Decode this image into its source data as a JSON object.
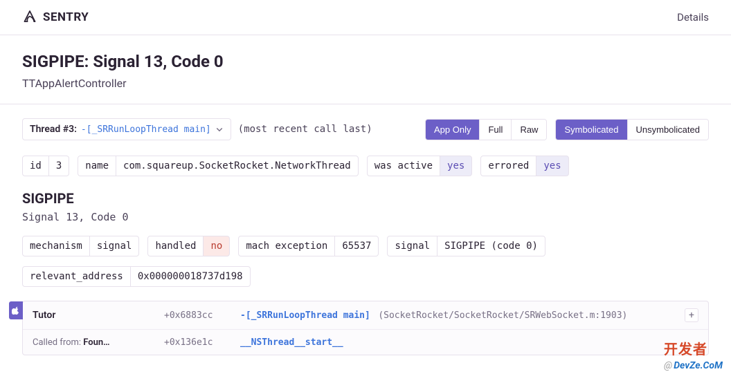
{
  "header": {
    "brand": "SENTRY",
    "details": "Details"
  },
  "title": {
    "main": "SIGPIPE: Signal 13, Code 0",
    "sub": "TTAppAlertController"
  },
  "thread": {
    "label": "Thread #3:",
    "func": "-[_SRRunLoopThread main]"
  },
  "recent": "(most recent call last)",
  "viewGroup": {
    "app": "App Only",
    "full": "Full",
    "raw": "Raw"
  },
  "symGroup": {
    "sym": "Symbolicated",
    "unsym": "Unsymbolicated"
  },
  "tags1": {
    "id": {
      "k": "id",
      "v": "3"
    },
    "name": {
      "k": "name",
      "v": "com.squareup.SocketRocket.NetworkThread"
    },
    "active": {
      "k": "was active",
      "v": "yes"
    },
    "errored": {
      "k": "errored",
      "v": "yes"
    }
  },
  "sig": {
    "title": "SIGPIPE",
    "sub": "Signal 13, Code 0"
  },
  "tags2": {
    "mech": {
      "k": "mechanism",
      "v": "signal"
    },
    "handled": {
      "k": "handled",
      "v": "no"
    },
    "mach": {
      "k": "mach exception",
      "v": "65537"
    },
    "signal": {
      "k": "signal",
      "v": "SIGPIPE (code 0)"
    }
  },
  "tags3": {
    "reladdr": {
      "k": "relevant_address",
      "v": "0x000000018737d198"
    }
  },
  "frames": [
    {
      "pkg": "Tutor",
      "addr": "+0x6883cc",
      "func": "-[_SRRunLoopThread main]",
      "src": "(SocketRocket/SocketRocket/SRWebSocket.m:1903)"
    },
    {
      "called_prefix": "Called from: ",
      "called_pkg": "Foun…",
      "addr": "+0x136e1c",
      "func": "__NSThread__start__"
    }
  ],
  "expand": "+",
  "watermark": {
    "cn": "开发者",
    "en": "DevZe.CoM",
    "at": "@"
  }
}
